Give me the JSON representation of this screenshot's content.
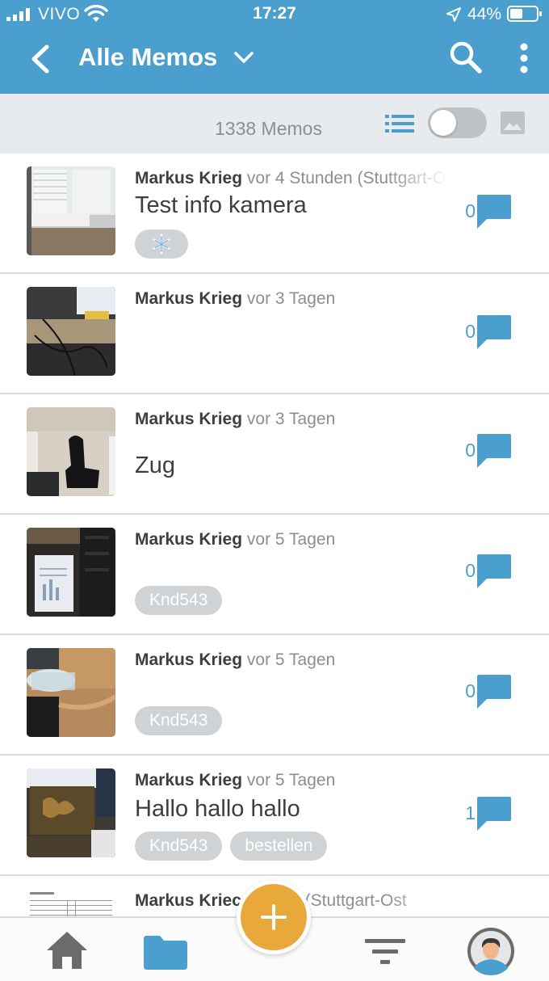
{
  "status_bar": {
    "carrier": "VIVO",
    "time": "17:27",
    "battery_percent": "44%",
    "icons": [
      "signal-icon",
      "wifi-icon",
      "location-arrow-icon",
      "battery-icon"
    ]
  },
  "app_bar": {
    "title": "Alle Memos",
    "icons": [
      "back-icon",
      "chevron-down-icon",
      "search-icon",
      "more-vertical-icon"
    ]
  },
  "toolbar": {
    "memo_count": "1338 Memos",
    "view_toggle_on": false,
    "icons": [
      "list-view-icon",
      "image-view-icon"
    ]
  },
  "colors": {
    "primary": "#4a9fcf",
    "accent": "#e8a93a",
    "tag_bg": "#d0d3d5",
    "text_dark": "#3b3f42",
    "text_muted": "#8a8f93"
  },
  "memos": [
    {
      "author": "Markus Krieg",
      "time": "vor 4 Stunden (Stuttgart-O",
      "title": "Test info kamera",
      "tags": [],
      "tag_icon": "snowflake-icon",
      "comments": "0"
    },
    {
      "author": "Markus Krieg",
      "time": "vor 3 Tagen",
      "title": "",
      "tags": [],
      "comments": "0"
    },
    {
      "author": "Markus Krieg",
      "time": "vor 3 Tagen",
      "title": "Zug",
      "tags": [],
      "comments": "0"
    },
    {
      "author": "Markus Krieg",
      "time": "vor 5 Tagen",
      "title": "",
      "tags": [
        "Knd543"
      ],
      "comments": "0"
    },
    {
      "author": "Markus Krieg",
      "time": "vor 5 Tagen",
      "title": "",
      "tags": [
        "Knd543"
      ],
      "comments": "0"
    },
    {
      "author": "Markus Krieg",
      "time": "vor 5 Tagen",
      "title": "Hallo hallo hallo",
      "tags": [
        "Knd543",
        "bestellen"
      ],
      "comments": "1"
    },
    {
      "author": "Markus Kriec",
      "time": "gen (Stuttgart-Ost",
      "title": "",
      "tags": [],
      "comments": ""
    }
  ],
  "bottom_nav": {
    "icons": [
      "home-icon",
      "folder-icon",
      "add-icon",
      "filter-icon",
      "avatar-icon"
    ]
  }
}
